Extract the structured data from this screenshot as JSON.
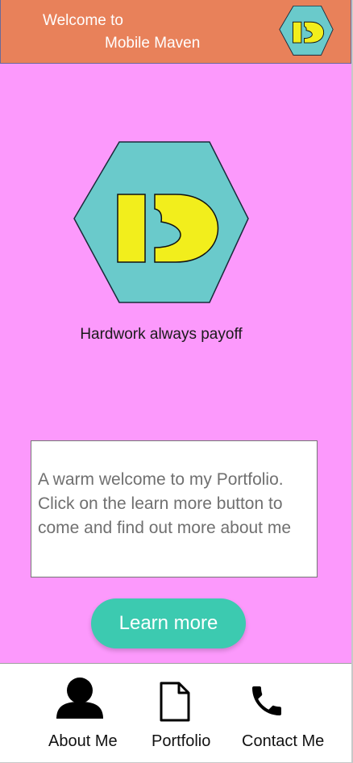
{
  "header": {
    "title_line1": "Welcome to",
    "title_line2": "Mobile Maven",
    "logo_icon": "hexagon-logo-icon"
  },
  "hero": {
    "logo_icon": "hexagon-logo-icon",
    "tagline": "Hardwork always payoff"
  },
  "welcome": {
    "text": "A warm welcome to my Portfolio. Click on the learn more button to come and find out more about me"
  },
  "cta": {
    "label": "Learn more"
  },
  "nav": {
    "items": [
      {
        "label": "About Me",
        "icon": "person-icon"
      },
      {
        "label": "Portfolio",
        "icon": "document-icon"
      },
      {
        "label": "Contact Me",
        "icon": "phone-icon"
      }
    ]
  },
  "colors": {
    "background": "#fc99fc",
    "header": "#e8815a",
    "hexagon": "#6acacb",
    "logo_letter": "#f2ee1c",
    "button": "#3ccab0"
  }
}
